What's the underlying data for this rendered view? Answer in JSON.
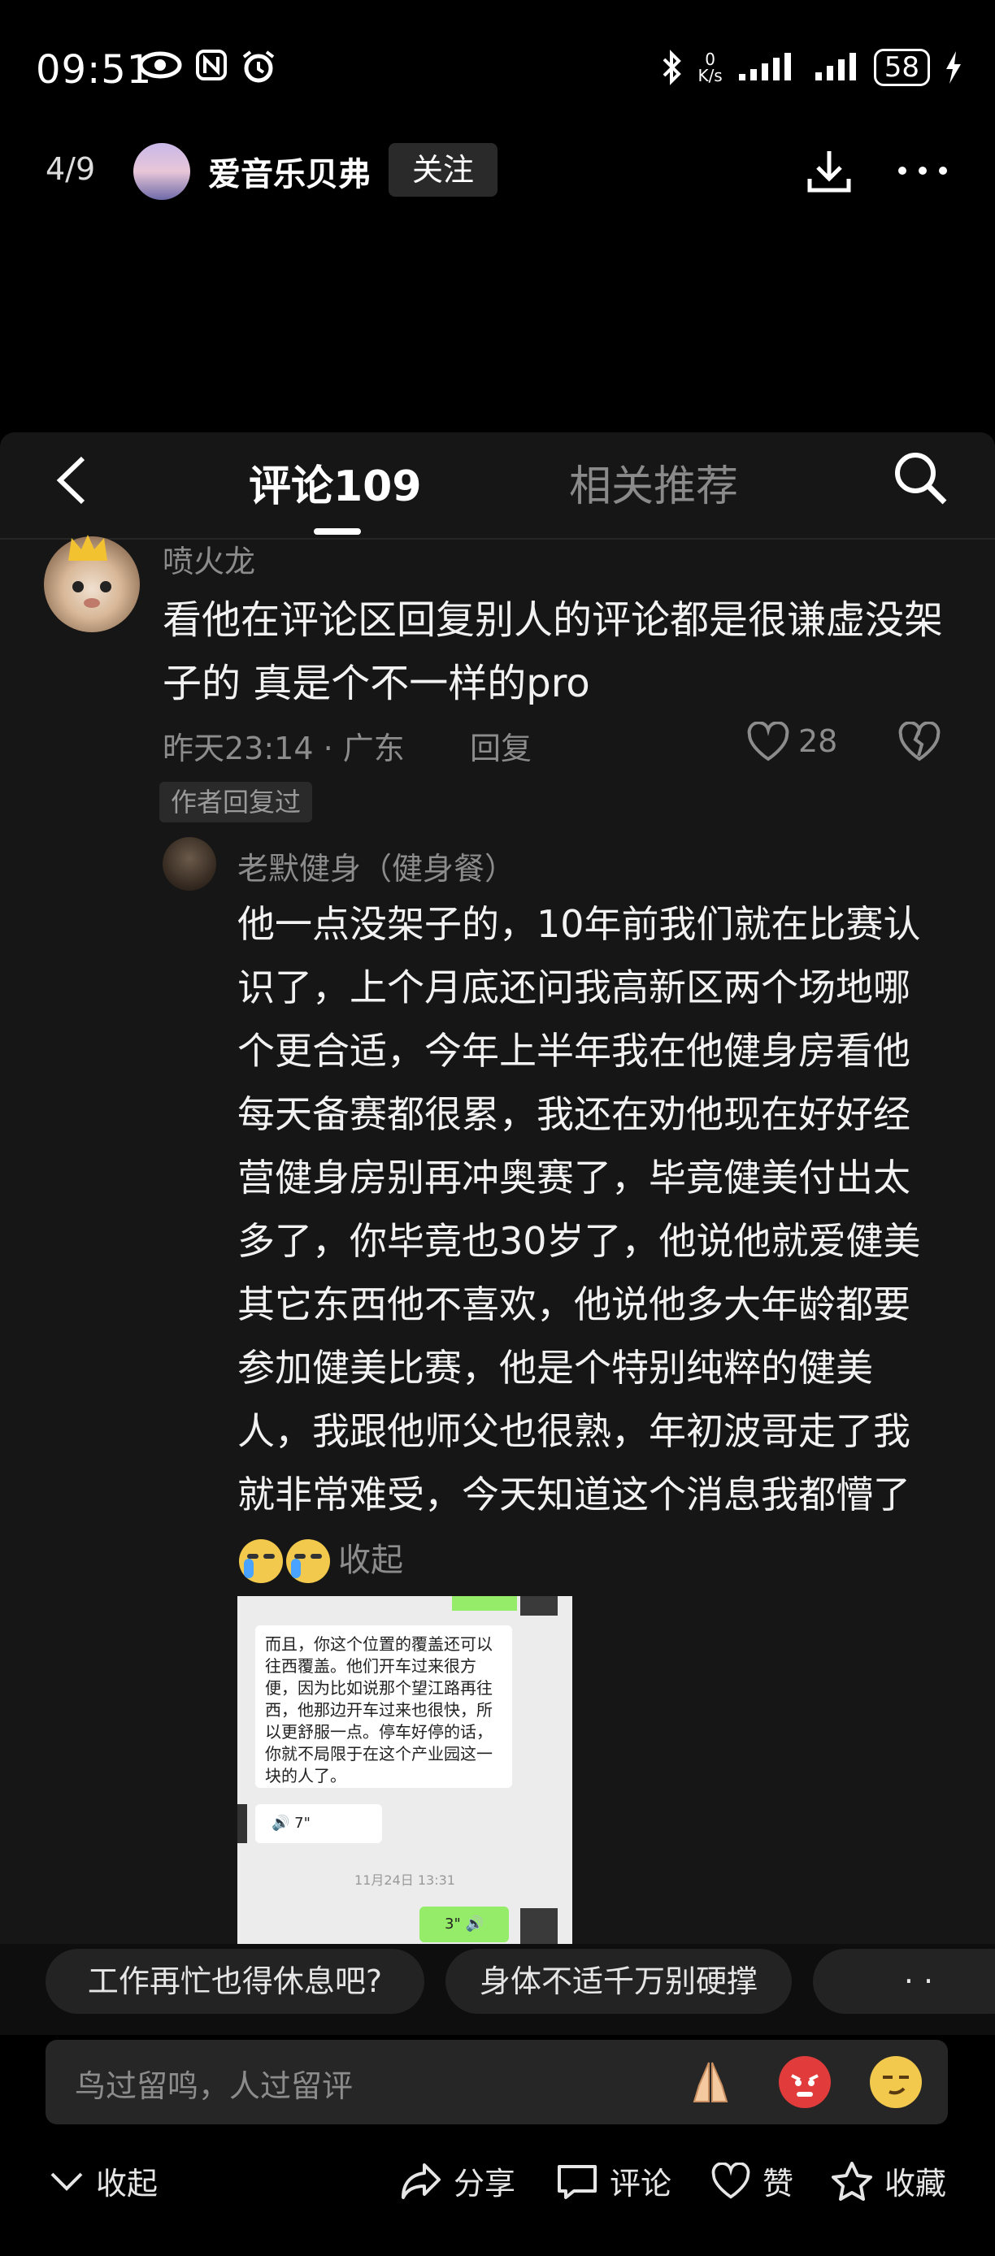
{
  "status_bar": {
    "time": "09:51",
    "net_speed_value": "0",
    "net_speed_unit": "K/s",
    "battery": "58"
  },
  "header": {
    "page_index": "4/9",
    "user_name": "爱音乐贝弗",
    "follow_label": "关注"
  },
  "comments_panel": {
    "tabs": [
      {
        "label": "评论109",
        "active": true
      },
      {
        "label": "相关推荐",
        "active": false
      }
    ],
    "comment": {
      "author": "喷火龙",
      "text": "看他在评论区回复别人的评论都是很谦虚没架子的  真是个不一样的pro",
      "time": "昨天23:14",
      "separator": "·",
      "location": "广东",
      "reply_label": "回复",
      "like_count": "28",
      "author_replied_badge": "作者回复过"
    },
    "reply": {
      "author": "老默健身（健身餐）",
      "text": "他一点没架子的，10年前我们就在比赛认识了，上个月底还问我高新区两个场地哪个更合适，今年上半年我在他健身房看他每天备赛都很累，我还在劝他现在好好经营健身房别再冲奥赛了，毕竟健美付出太多了，你毕竟也30岁了，他说他就爱健美其它东西他不喜欢，他说他多大年龄都要参加健美比赛，他是个特别纯粹的健美人，我跟他师父也很熟，年初波哥走了我就非常难受，今天知道这个消息我都懵了",
      "collapse_label": "收起",
      "screenshot": {
        "message": "而且，你这个位置的覆盖还可以往西覆盖。他们开车过来很方便，因为比如说那个望江路再往西，他那边开车过来也很快，所以更舒服一点。停车好停的话，你就不局限于在这个产业园这一块的人了。",
        "voice_left": "7\"",
        "timestamp": "11月24日 13:31",
        "voice_right": "3\""
      }
    }
  },
  "suggestions": [
    "工作再忙也得休息吧?",
    "身体不适千万别硬撑",
    "· ·"
  ],
  "input": {
    "placeholder": "鸟过留鸣，人过留评"
  },
  "bottom_bar": {
    "collapse": "收起",
    "share": "分享",
    "comment": "评论",
    "like": "赞",
    "favorite": "收藏"
  }
}
